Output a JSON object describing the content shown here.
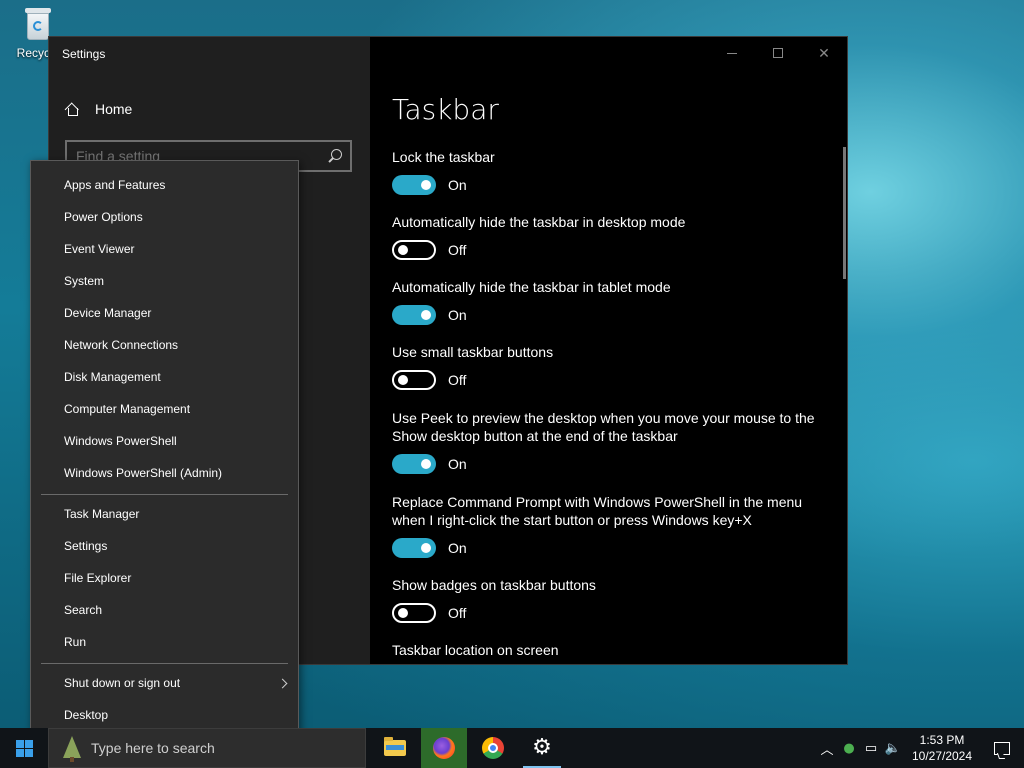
{
  "desktop": {
    "recycle_bin_label": "Recycle"
  },
  "settings_window": {
    "title": "Settings",
    "home_label": "Home",
    "search_placeholder": "Find a setting",
    "page_title": "Taskbar",
    "settings": [
      {
        "label": "Lock the taskbar",
        "state": "On",
        "on": true
      },
      {
        "label": "Automatically hide the taskbar in desktop mode",
        "state": "Off",
        "on": false
      },
      {
        "label": "Automatically hide the taskbar in tablet mode",
        "state": "On",
        "on": true
      },
      {
        "label": "Use small taskbar buttons",
        "state": "Off",
        "on": false
      },
      {
        "label": "Use Peek to preview the desktop when you move your mouse to the Show desktop button at the end of the taskbar",
        "state": "On",
        "on": true
      },
      {
        "label": "Replace Command Prompt with Windows PowerShell in the menu when I right-click the start button or press Windows key+X",
        "state": "On",
        "on": true
      },
      {
        "label": "Show badges on taskbar buttons",
        "state": "Off",
        "on": false
      }
    ],
    "taskbar_location_label": "Taskbar location on screen",
    "accent_color": "#2aa9c9"
  },
  "context_menu": {
    "group1": [
      "Apps and Features",
      "Power Options",
      "Event Viewer",
      "System",
      "Device Manager",
      "Network Connections",
      "Disk Management",
      "Computer Management",
      "Windows PowerShell",
      "Windows PowerShell (Admin)"
    ],
    "group2": [
      "Task Manager",
      "Settings",
      "File Explorer",
      "Search",
      "Run"
    ],
    "group3": [
      "Shut down or sign out",
      "Desktop"
    ]
  },
  "taskbar": {
    "search_placeholder": "Type here to search",
    "pinned_apps": [
      "file-explorer-icon",
      "firefox-icon",
      "chrome-icon",
      "settings-gear-icon"
    ],
    "clock_time": "1:53 PM",
    "clock_date": "10/27/2024"
  }
}
